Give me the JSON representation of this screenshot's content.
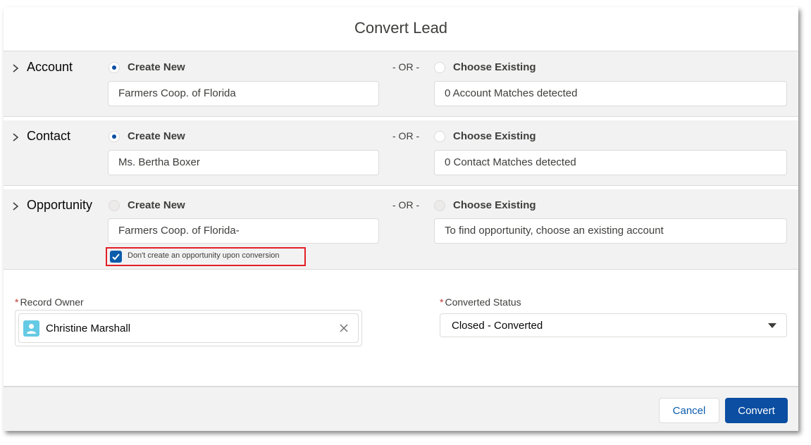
{
  "modal": {
    "title": "Convert Lead"
  },
  "or_label": "- OR -",
  "sections": {
    "account": {
      "label": "Account",
      "create_new_label": "Create New",
      "choose_existing_label": "Choose Existing",
      "new_value": "Farmers Coop. of Florida",
      "existing_value": "0 Account Matches detected",
      "selected": "create_new"
    },
    "contact": {
      "label": "Contact",
      "create_new_label": "Create New",
      "choose_existing_label": "Choose Existing",
      "new_value": "Ms. Bertha Boxer",
      "existing_value": "0 Contact Matches detected",
      "selected": "create_new"
    },
    "opportunity": {
      "label": "Opportunity",
      "create_new_label": "Create New",
      "choose_existing_label": "Choose Existing",
      "new_value": "Farmers Coop. of Florida-",
      "existing_value": "To find opportunity, choose an existing account",
      "selected": "none",
      "no_opportunity_checkbox_label": "Don't create an opportunity upon conversion",
      "no_opportunity_checked": true
    }
  },
  "record_owner": {
    "label": "Record Owner",
    "value": "Christine Marshall"
  },
  "converted_status": {
    "label": "Converted Status",
    "value": "Closed - Converted"
  },
  "footer": {
    "cancel_label": "Cancel",
    "convert_label": "Convert"
  },
  "colors": {
    "brand": "#0b4ea2",
    "required": "#c23934",
    "highlight": "#e21f26",
    "section_bg": "#f3f2f2"
  }
}
